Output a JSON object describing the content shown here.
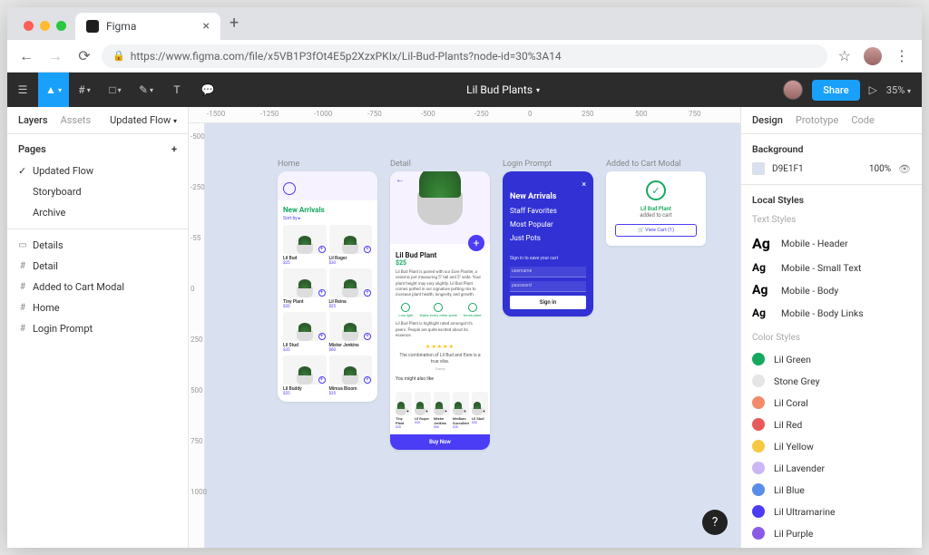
{
  "browser": {
    "tab_title": "Figma",
    "url": "https://www.figma.com/file/x5VB1P3fOt4E5p2XzxPKIx/Lil-Bud-Plants?node-id=30%3A14"
  },
  "toolbar": {
    "document_title": "Lil Bud Plants",
    "share_label": "Share",
    "zoom": "35%"
  },
  "left_panel": {
    "tabs": [
      "Layers",
      "Assets"
    ],
    "page_dropdown": "Updated Flow",
    "pages_header": "Pages",
    "pages": [
      {
        "label": "Updated Flow",
        "active": true
      },
      {
        "label": "Storyboard",
        "active": false
      },
      {
        "label": "Archive",
        "active": false
      }
    ],
    "layers": [
      {
        "icon": "rect",
        "label": "Details"
      },
      {
        "icon": "frame",
        "label": "Detail"
      },
      {
        "icon": "frame",
        "label": "Added to Cart Modal"
      },
      {
        "icon": "frame",
        "label": "Home"
      },
      {
        "icon": "frame",
        "label": "Login Prompt"
      }
    ]
  },
  "ruler_h": [
    "-1500",
    "-1250",
    "-1000",
    "-750",
    "-500",
    "-250",
    "0",
    "250",
    "500",
    "750"
  ],
  "ruler_v": [
    "-500",
    "-250",
    "-55",
    "0",
    "250",
    "500",
    "750",
    "1000"
  ],
  "frames": {
    "home": {
      "label": "Home",
      "section": "New Arrivals",
      "sort": "Sort by ▸",
      "products": [
        {
          "name": "Lil Bud",
          "price": "$25"
        },
        {
          "name": "Lil Roger",
          "price": "$30"
        },
        {
          "name": "Tiny Plant",
          "price": "$20"
        },
        {
          "name": "Lil Reina",
          "price": "$25"
        },
        {
          "name": "Lil Stud",
          "price": "$35"
        },
        {
          "name": "Mister Jenkins",
          "price": "$60"
        },
        {
          "name": "Lil Buddy",
          "price": "$25"
        },
        {
          "name": "Mimsa Bloom",
          "price": "$35"
        }
      ]
    },
    "detail": {
      "label": "Detail",
      "name": "Lil Bud Plant",
      "price": "$25",
      "desc": "Lil Bud Plant is paired with our Eore Planter, a ceramic pot measuring 5\" tall and 5\" wide. Your plant height may vary slightly. Lil Bud Plant comes potted in our signature potting mix to increase plant health, longevity, and growth.",
      "care": [
        "Low light",
        "Water every other week",
        "Small plant"
      ],
      "review": "Lil Bud Plant is highlight rated amongst it's peers. People are quite excited about its essence.",
      "quote": "The combination of Lil Bud and Eore is a true vibe.",
      "quote_by": "Tracey",
      "also_like": "You might also like",
      "recs": [
        {
          "name": "Tiny Plant",
          "price": "$20"
        },
        {
          "name": "Lil Roger",
          "price": "$30"
        },
        {
          "name": "Mister Jenkins",
          "price": "$60"
        },
        {
          "name": "Medium Succulent",
          "price": "$30"
        },
        {
          "name": "Lil Stud",
          "price": "$35"
        }
      ],
      "buy": "Buy Now"
    },
    "login": {
      "label": "Login Prompt",
      "links": [
        "New Arrivals",
        "Staff Favorites",
        "Most Popular",
        "Just Pots"
      ],
      "cta": "Sign in to save your cart",
      "user_label": "username",
      "pass_label": "password",
      "signin": "Sign in"
    },
    "cart": {
      "label": "Added to Cart Modal",
      "name": "Lil Bud Plant",
      "msg": "added to cart",
      "button": "🛒 View Cart (1)"
    }
  },
  "right_panel": {
    "tabs": [
      "Design",
      "Prototype",
      "Code"
    ],
    "bg_header": "Background",
    "bg_hex": "D9E1F1",
    "bg_alpha": "100%",
    "local_styles": "Local Styles",
    "text_styles_label": "Text Styles",
    "text_styles": [
      {
        "sample": "Ag",
        "size": "h",
        "name": "Mobile - Header"
      },
      {
        "sample": "Ag",
        "size": "sm",
        "name": "Mobile - Small Text"
      },
      {
        "sample": "Ag",
        "size": "md",
        "name": "Mobile - Body"
      },
      {
        "sample": "Ag",
        "size": "sm",
        "name": "Mobile - Body Links"
      }
    ],
    "color_styles_label": "Color Styles",
    "color_styles": [
      {
        "name": "Lil Green",
        "hex": "#15a85f"
      },
      {
        "name": "Stone Grey",
        "hex": "#e5e5e5"
      },
      {
        "name": "Lil Coral",
        "hex": "#f28b6b"
      },
      {
        "name": "Lil Red",
        "hex": "#e85a5a"
      },
      {
        "name": "Lil Yellow",
        "hex": "#f5c944"
      },
      {
        "name": "Lil Lavender",
        "hex": "#c9b8f5"
      },
      {
        "name": "Lil Blue",
        "hex": "#5a8de8"
      },
      {
        "name": "Lil Ultramarine",
        "hex": "#4b3cf5"
      },
      {
        "name": "Lil Purple",
        "hex": "#8b5ae8"
      }
    ]
  }
}
